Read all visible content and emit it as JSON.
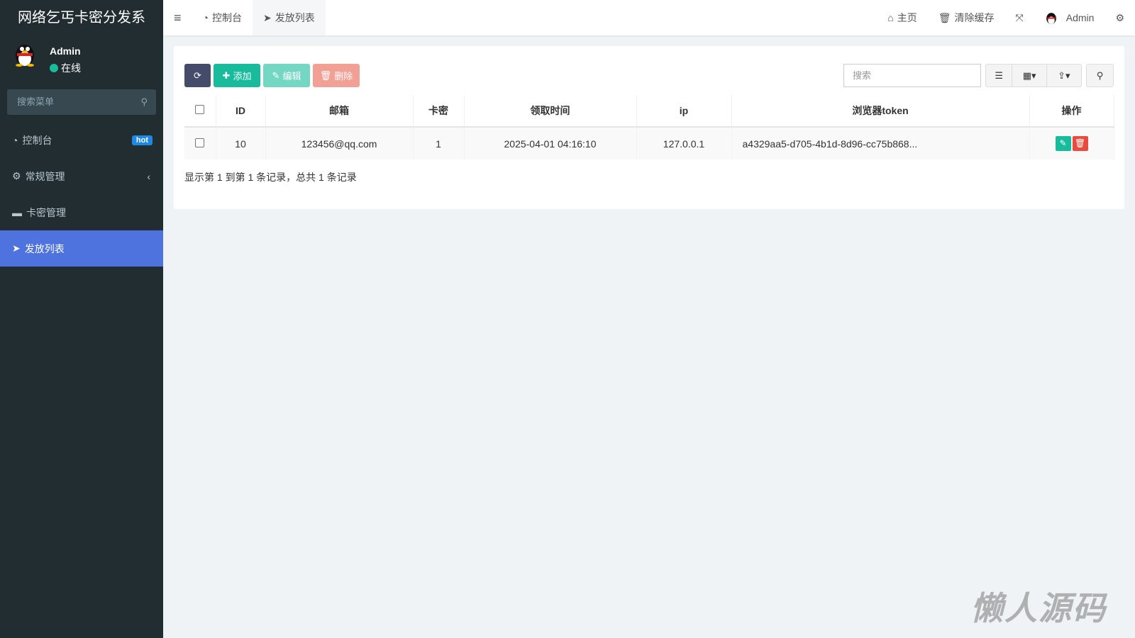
{
  "sidebar": {
    "title": "网络乞丐卡密分发系",
    "user": "Admin",
    "status": "在线",
    "search_placeholder": "搜索菜单",
    "items": [
      {
        "label": "控制台",
        "badge": "hot"
      },
      {
        "label": "常规管理",
        "caret": "‹"
      },
      {
        "label": "卡密管理"
      },
      {
        "label": "发放列表"
      }
    ]
  },
  "header": {
    "tabs": [
      {
        "label": "控制台"
      },
      {
        "label": "发放列表"
      }
    ],
    "home": "主页",
    "clear_cache": "清除缓存",
    "user": "Admin"
  },
  "toolbar": {
    "add": "添加",
    "edit": "编辑",
    "delete": "删除",
    "search_placeholder": "搜索"
  },
  "table": {
    "columns": [
      "ID",
      "邮箱",
      "卡密",
      "领取时间",
      "ip",
      "浏览器token",
      "操作"
    ],
    "rows": [
      {
        "id": "10",
        "email": "123456@qq.com",
        "card": "1",
        "time": "2025-04-01 04:16:10",
        "ip": "127.0.0.1",
        "token": "a4329aa5-d705-4b1d-8d96-cc75b868..."
      }
    ]
  },
  "summary": "显示第 1 到第 1 条记录，总共 1 条记录",
  "watermark": "懒人源码",
  "colors": {
    "sidebar": "#222d32",
    "active": "#4e73df",
    "success": "#18bc9c",
    "danger": "#e74c3c",
    "dark": "#444c69"
  }
}
